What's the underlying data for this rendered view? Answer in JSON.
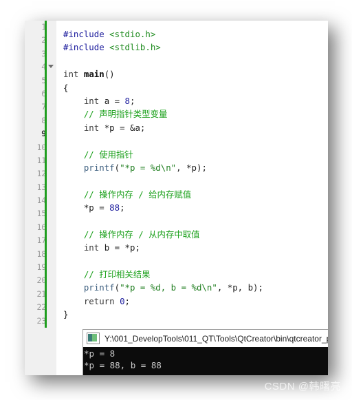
{
  "editor": {
    "gutter": {
      "lines": [
        {
          "n": "1",
          "chg": true,
          "fold": false,
          "cur": false
        },
        {
          "n": "2",
          "chg": true,
          "fold": false,
          "cur": false
        },
        {
          "n": "3",
          "chg": true,
          "fold": false,
          "cur": false
        },
        {
          "n": "4",
          "chg": true,
          "fold": true,
          "cur": false
        },
        {
          "n": "5",
          "chg": true,
          "fold": false,
          "cur": false
        },
        {
          "n": "6",
          "chg": true,
          "fold": false,
          "cur": false
        },
        {
          "n": "7",
          "chg": true,
          "fold": false,
          "cur": false
        },
        {
          "n": "8",
          "chg": true,
          "fold": false,
          "cur": false
        },
        {
          "n": "9",
          "chg": true,
          "fold": false,
          "cur": true
        },
        {
          "n": "10",
          "chg": true,
          "fold": false,
          "cur": false
        },
        {
          "n": "11",
          "chg": true,
          "fold": false,
          "cur": false
        },
        {
          "n": "12",
          "chg": true,
          "fold": false,
          "cur": false
        },
        {
          "n": "13",
          "chg": true,
          "fold": false,
          "cur": false
        },
        {
          "n": "14",
          "chg": true,
          "fold": false,
          "cur": false
        },
        {
          "n": "15",
          "chg": true,
          "fold": false,
          "cur": false
        },
        {
          "n": "16",
          "chg": true,
          "fold": false,
          "cur": false
        },
        {
          "n": "17",
          "chg": true,
          "fold": false,
          "cur": false
        },
        {
          "n": "18",
          "chg": true,
          "fold": false,
          "cur": false
        },
        {
          "n": "19",
          "chg": true,
          "fold": false,
          "cur": false
        },
        {
          "n": "20",
          "chg": true,
          "fold": false,
          "cur": false
        },
        {
          "n": "21",
          "chg": true,
          "fold": false,
          "cur": false
        },
        {
          "n": "22",
          "chg": true,
          "fold": false,
          "cur": false
        },
        {
          "n": "23",
          "chg": true,
          "fold": false,
          "cur": false
        }
      ]
    },
    "code_lines": [
      "#include <stdio.h>",
      "#include <stdlib.h>",
      "",
      "int main()",
      "{",
      "    int a = 8;",
      "    // 声明指针类型变量",
      "    int *p = &a;",
      "",
      "    // 使用指针",
      "    printf(\"*p = %d\\n\", *p);",
      "",
      "    // 操作内存 / 给内存赋值",
      "    *p = 88;",
      "",
      "    // 操作内存 / 从内存中取值",
      "    int b = *p;",
      "",
      "    // 打印相关结果",
      "    printf(\"*p = %d, b = %d\\n\", *p, b);",
      "    return 0;",
      "}",
      ""
    ],
    "colors": {
      "preprocessor": "#1a1a9c",
      "header": "#1e8b1e",
      "keyword": "#3b3b3b",
      "function": "#101010",
      "number": "#1a1a9c",
      "string": "#1e7d1e",
      "comment": "#1aa01a",
      "gutter_bg": "#f0f0f0",
      "change_bar": "#1e9e1e",
      "editor_bg": "#ffffff"
    }
  },
  "console": {
    "icon": "console-window-icon",
    "title": "Y:\\001_DevelopTools\\011_QT\\Tools\\QtCreator\\bin\\qtcreator_p",
    "output_lines": [
      "*p = 8",
      "*p = 88, b = 88"
    ],
    "colors": {
      "background": "#0c0c0c",
      "text": "#c8c8c8",
      "titlebar": "#ffffff"
    }
  },
  "watermark": {
    "text": "CSDN @韩曙亮"
  }
}
